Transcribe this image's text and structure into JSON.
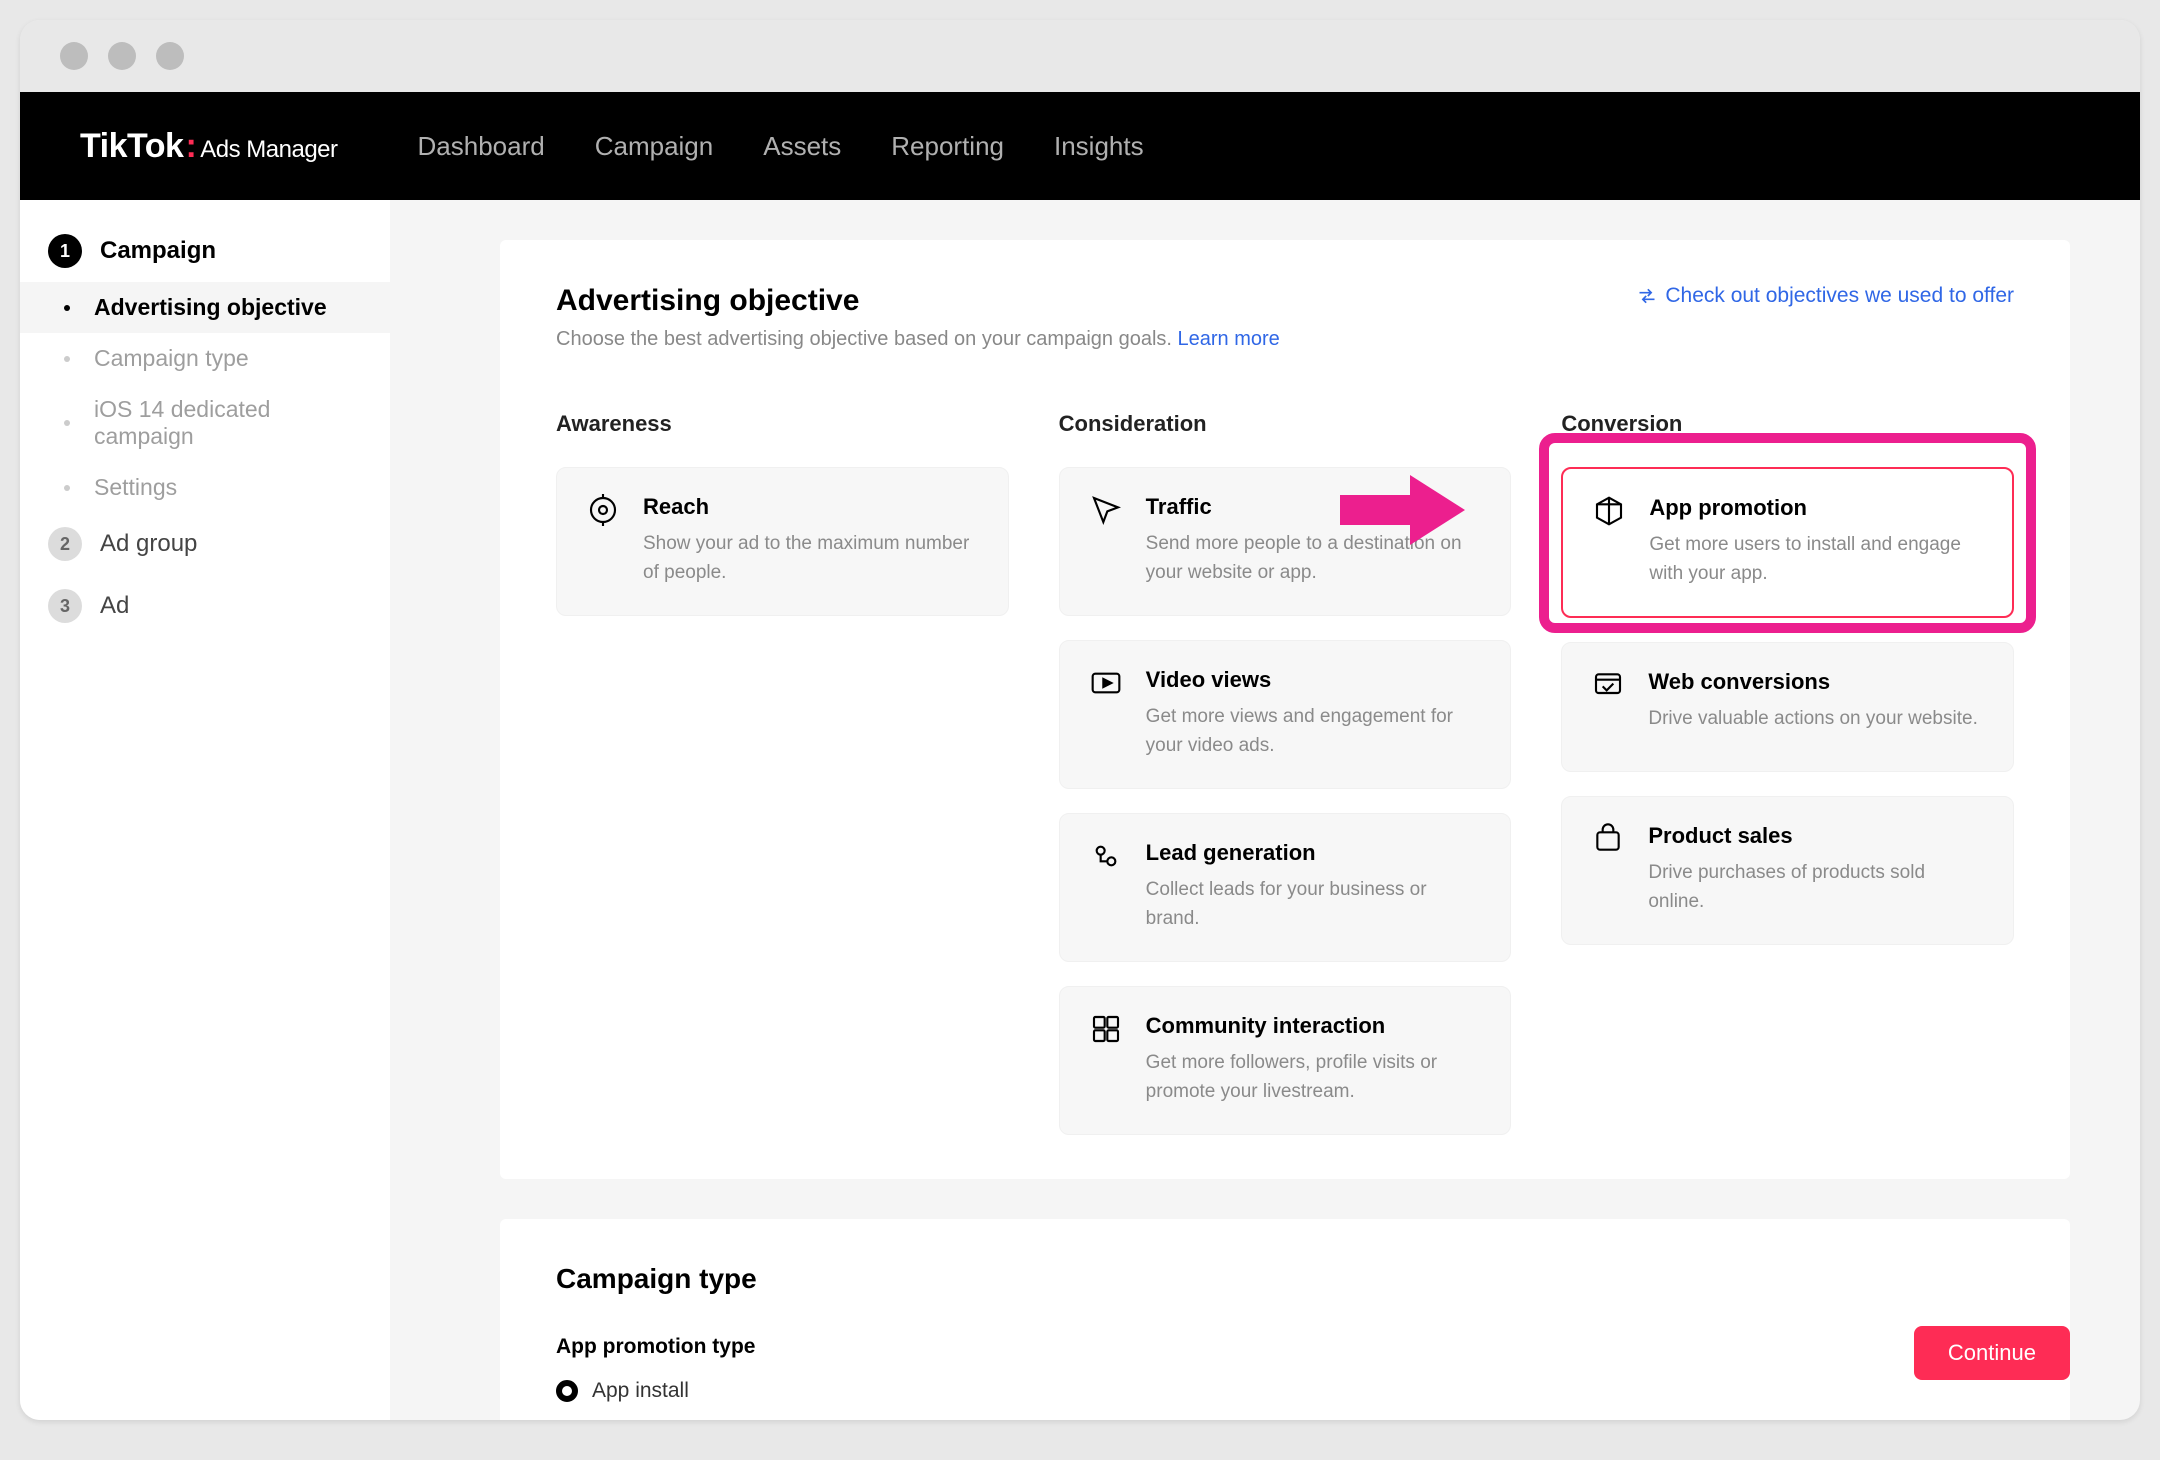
{
  "brand": {
    "name": "TikTok",
    "sub": "Ads Manager"
  },
  "nav": [
    "Dashboard",
    "Campaign",
    "Assets",
    "Reporting",
    "Insights"
  ],
  "sidebar": {
    "steps": [
      {
        "num": "1",
        "label": "Campaign",
        "active": true
      },
      {
        "num": "2",
        "label": "Ad group",
        "active": false
      },
      {
        "num": "3",
        "label": "Ad",
        "active": false
      }
    ],
    "substeps": [
      {
        "label": "Advertising objective",
        "current": true
      },
      {
        "label": "Campaign type",
        "current": false
      },
      {
        "label": "iOS 14 dedicated campaign",
        "current": false
      },
      {
        "label": "Settings",
        "current": false
      }
    ]
  },
  "panel": {
    "title": "Advertising objective",
    "subtitle": "Choose the best advertising objective based on your campaign goals.",
    "learn_more": "Learn more",
    "check_offer": "Check out objectives we used to offer"
  },
  "columns": {
    "awareness": {
      "head": "Awareness",
      "cards": [
        {
          "title": "Reach",
          "desc": "Show your ad to the maximum number of people.",
          "icon": "reach"
        }
      ]
    },
    "consideration": {
      "head": "Consideration",
      "cards": [
        {
          "title": "Traffic",
          "desc": "Send more people to a destination on your website or app.",
          "icon": "traffic"
        },
        {
          "title": "Video views",
          "desc": "Get more views and engagement for your video ads.",
          "icon": "video"
        },
        {
          "title": "Lead generation",
          "desc": "Collect leads for your business or brand.",
          "icon": "lead"
        },
        {
          "title": "Community interaction",
          "desc": "Get more followers, profile visits or promote your livestream.",
          "icon": "community"
        }
      ]
    },
    "conversion": {
      "head": "Conversion",
      "cards": [
        {
          "title": "App promotion",
          "desc": "Get more users to install and engage with your app.",
          "icon": "app",
          "selected": true
        },
        {
          "title": "Web conversions",
          "desc": "Drive valuable actions on your website.",
          "icon": "web"
        },
        {
          "title": "Product sales",
          "desc": "Drive purchases of products sold online.",
          "icon": "product"
        }
      ]
    }
  },
  "campaign_type": {
    "title": "Campaign type",
    "field": "App promotion type",
    "option": "App install"
  },
  "footer": {
    "continue": "Continue"
  }
}
